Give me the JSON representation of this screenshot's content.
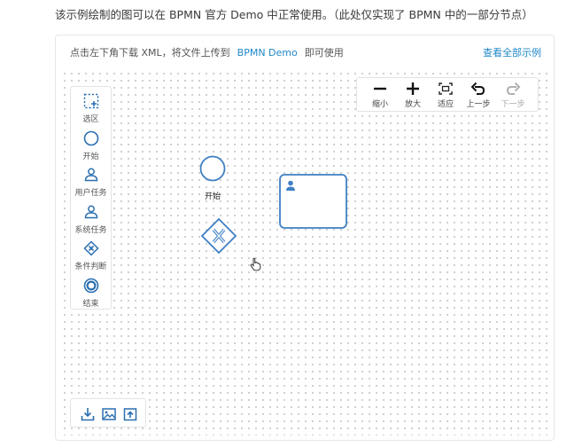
{
  "intro_text": "该示例绘制的图可以在 BPMN 官方 Demo 中正常使用。（此处仅实现了 BPMN 中的一部分节点）",
  "header": {
    "hint_prefix": "点击左下角下载 XML，将文件上传到",
    "hint_link": "BPMN Demo",
    "hint_suffix": "即可使用",
    "view_all": "查看全部示例"
  },
  "palette": {
    "items": [
      {
        "label": "选区",
        "icon": "select-region-icon"
      },
      {
        "label": "开始",
        "icon": "start-event-icon"
      },
      {
        "label": "用户任务",
        "icon": "user-task-icon"
      },
      {
        "label": "系统任务",
        "icon": "system-task-icon"
      },
      {
        "label": "条件判断",
        "icon": "exclusive-gateway-icon"
      },
      {
        "label": "结束",
        "icon": "end-event-icon"
      }
    ]
  },
  "toolbar": {
    "items": [
      {
        "label": "缩小",
        "icon": "zoom-out-icon",
        "enabled": true
      },
      {
        "label": "放大",
        "icon": "zoom-in-icon",
        "enabled": true
      },
      {
        "label": "适应",
        "icon": "fit-view-icon",
        "enabled": true
      },
      {
        "label": "上一步",
        "icon": "undo-icon",
        "enabled": true
      },
      {
        "label": "下一步",
        "icon": "redo-icon",
        "enabled": false
      }
    ]
  },
  "bottom_bar": {
    "icons": [
      "download-xml-icon",
      "export-image-icon",
      "upload-icon"
    ]
  },
  "diagram": {
    "start_label": "开始"
  },
  "colors": {
    "accent": "#1e88c8",
    "node_stroke": "#3f7fc4",
    "icon_blue": "#2a6fb0"
  }
}
